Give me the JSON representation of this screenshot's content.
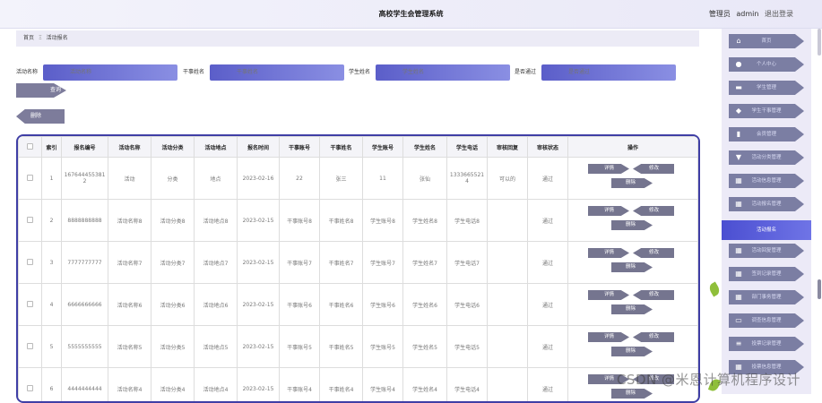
{
  "header": {
    "title": "高校学生会管理系统",
    "role_label": "管理员",
    "username": "admin",
    "logout_label": "退出登录"
  },
  "breadcrumb": {
    "home": "首页",
    "separator": "Ξ",
    "current": "活动报名"
  },
  "search": {
    "fields": [
      {
        "label": "活动名称",
        "placeholder": "活动名称"
      },
      {
        "label": "干事姓名",
        "placeholder": "干事姓名"
      },
      {
        "label": "学生姓名",
        "placeholder": "学生姓名"
      },
      {
        "label": "是否通过",
        "placeholder": "是否通过"
      }
    ],
    "query_label": "查询",
    "delete_label": "删除"
  },
  "table": {
    "columns": [
      "",
      "索引",
      "报名编号",
      "活动名称",
      "活动分类",
      "活动地点",
      "报名时间",
      "干事账号",
      "干事姓名",
      "学生账号",
      "学生姓名",
      "学生电话",
      "审核回复",
      "审核状态",
      "操作"
    ],
    "rows": [
      [
        "1",
        "1676444553812",
        "活动",
        "分类",
        "地点",
        "2023-02-16",
        "22",
        "张三",
        "11",
        "张仙",
        "13336655214",
        "可以的",
        "通过"
      ],
      [
        "2",
        "8888888888",
        "活动名称8",
        "活动分类8",
        "活动地点8",
        "2023-02-15",
        "干事账号8",
        "干事姓名8",
        "学生账号8",
        "学生姓名8",
        "学生电话8",
        "",
        "通过"
      ],
      [
        "3",
        "7777777777",
        "活动名称7",
        "活动分类7",
        "活动地点7",
        "2023-02-15",
        "干事账号7",
        "干事姓名7",
        "学生账号7",
        "学生姓名7",
        "学生电话7",
        "",
        "通过"
      ],
      [
        "4",
        "6666666666",
        "活动名称6",
        "活动分类6",
        "活动地点6",
        "2023-02-15",
        "干事账号6",
        "干事姓名6",
        "学生账号6",
        "学生姓名6",
        "学生电话6",
        "",
        "通过"
      ],
      [
        "5",
        "5555555555",
        "活动名称5",
        "活动分类5",
        "活动地点5",
        "2023-02-15",
        "干事账号5",
        "干事姓名5",
        "学生账号5",
        "学生姓名5",
        "学生电话5",
        "",
        "通过"
      ],
      [
        "6",
        "4444444444",
        "活动名称4",
        "活动分类4",
        "活动地点4",
        "2023-02-15",
        "干事账号4",
        "干事姓名4",
        "学生账号4",
        "学生姓名4",
        "学生电话4",
        "",
        "通过"
      ]
    ],
    "actions": {
      "detail": "详情",
      "edit": "修改",
      "delete": "删除"
    }
  },
  "sidebar": {
    "items": [
      {
        "label": "首页",
        "icon": "home-icon"
      },
      {
        "label": "个人中心",
        "icon": "user-icon"
      },
      {
        "label": "学生管理",
        "icon": "folder-icon"
      },
      {
        "label": "学生干事管理",
        "icon": "tag-icon"
      },
      {
        "label": "会员管理",
        "icon": "chart-icon"
      },
      {
        "label": "活动分类管理",
        "icon": "filter-icon"
      },
      {
        "label": "活动信息管理",
        "icon": "grid-icon"
      },
      {
        "label": "活动报名管理",
        "icon": "grid-icon"
      },
      {
        "label": "活动报名",
        "icon": "",
        "active": true
      },
      {
        "label": "活动回复管理",
        "icon": "grid-icon"
      },
      {
        "label": "签到记录管理",
        "icon": "grid-icon"
      },
      {
        "label": "部门事务管理",
        "icon": "grid-icon"
      },
      {
        "label": "调查信息管理",
        "icon": "message-icon"
      },
      {
        "label": "投票记录管理",
        "icon": "list-icon"
      },
      {
        "label": "投票信息管理",
        "icon": "grid-icon"
      }
    ]
  },
  "watermark": "CSDN @米恩计算机程序设计"
}
